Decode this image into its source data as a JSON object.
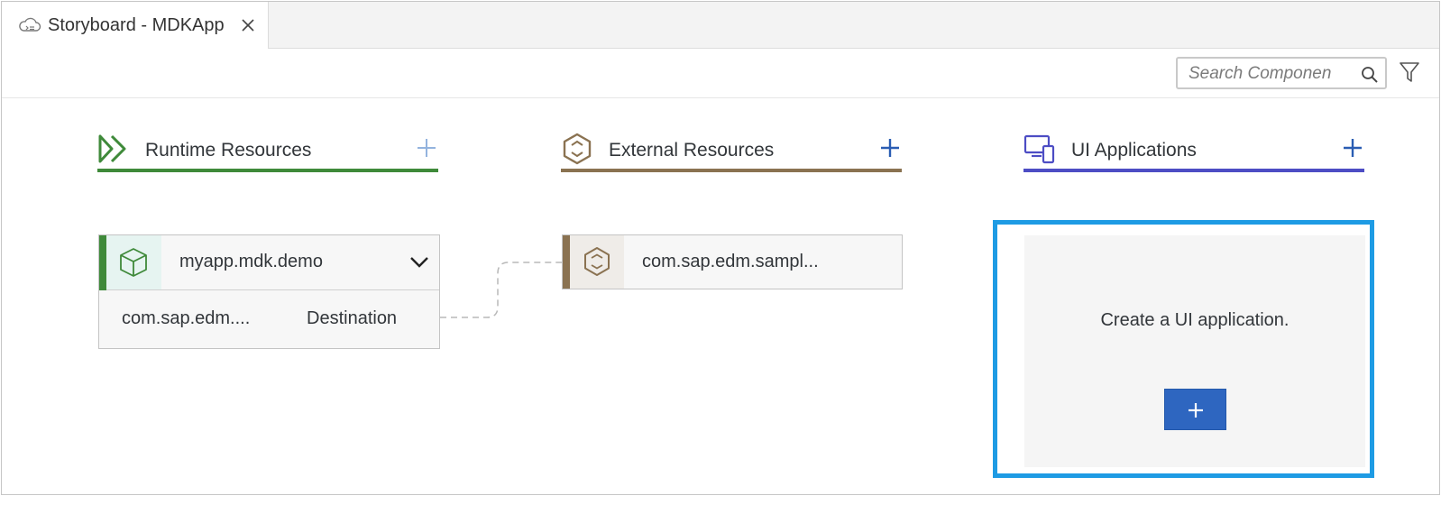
{
  "tab": {
    "title": "Storyboard - MDKApp",
    "icon": "cloud-storyboard-icon"
  },
  "toolbar": {
    "search_placeholder": "Search Componen"
  },
  "columns": [
    {
      "title": "Runtime Resources",
      "icon": "double-chevron-right-icon",
      "color": "#3f8a3a",
      "add_color": "#93b3de"
    },
    {
      "title": "External Resources",
      "icon": "hexagon-cube-icon",
      "color": "#8a7251",
      "add_color": "#2a5db3"
    },
    {
      "title": "UI Applications",
      "icon": "devices-icon",
      "color": "#4d4dc4",
      "add_color": "#2a5db3"
    }
  ],
  "runtime_card": {
    "name": "myapp.mdk.demo",
    "service": "com.sap.edm....",
    "service_type": "Destination"
  },
  "external_card": {
    "name": "com.sap.edm.sampl..."
  },
  "ui_panel": {
    "message": "Create a UI application.",
    "add_label": "+"
  },
  "colors": {
    "highlight": "#1e9be4",
    "primary_button": "#2e66c0"
  }
}
